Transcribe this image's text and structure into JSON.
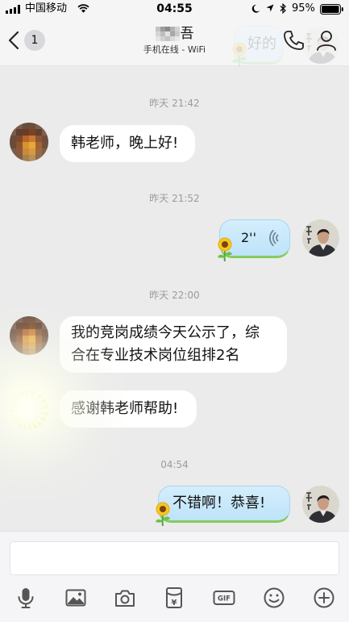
{
  "status_bar": {
    "carrier": "中国移动",
    "time": "04:55",
    "battery_percent": "95%",
    "icons": [
      "signal-icon",
      "wifi-icon",
      "moon-icon",
      "location-icon",
      "bluetooth-icon",
      "battery-icon"
    ]
  },
  "header": {
    "back_badge": "1",
    "title_visible_char": "吾",
    "subtitle": "手机在线 - WiFi",
    "icons": [
      "back-chevron-icon",
      "phone-icon",
      "profile-icon"
    ]
  },
  "chat": {
    "peek_message": "好的",
    "timestamps": [
      "昨天 21:42",
      "昨天 21:52",
      "昨天 22:00",
      "04:54"
    ],
    "messages": [
      {
        "outgoing": false,
        "lines": [
          "韩老师，晚上好!"
        ]
      },
      {
        "outgoing": true,
        "voice_duration": "2''"
      },
      {
        "outgoing": false,
        "lines": [
          "我的竞岗成绩今天公示了，综",
          "合在专业技术岗位组排2名"
        ]
      },
      {
        "outgoing": false,
        "lines": [
          "感谢韩老师帮助!"
        ]
      },
      {
        "outgoing": true,
        "lines": [
          "不错啊！恭喜!"
        ]
      }
    ]
  },
  "input": {
    "placeholder": ""
  },
  "toolbar": {
    "items": [
      {
        "icon": "microphone-icon"
      },
      {
        "icon": "image-icon"
      },
      {
        "icon": "camera-icon"
      },
      {
        "icon": "red-packet-icon",
        "symbol": "¥"
      },
      {
        "icon": "gif-icon",
        "label": "GIF"
      },
      {
        "icon": "emoji-icon"
      },
      {
        "icon": "plus-icon"
      }
    ]
  },
  "colors": {
    "chat_background": "#ebebeb",
    "incoming_bubble": "#ffffff",
    "outgoing_bubble": "#c4e6fa",
    "outgoing_bubble_accent": "#86cb5d",
    "timestamp_text": "#9b9b9b",
    "icon": "#555555"
  }
}
